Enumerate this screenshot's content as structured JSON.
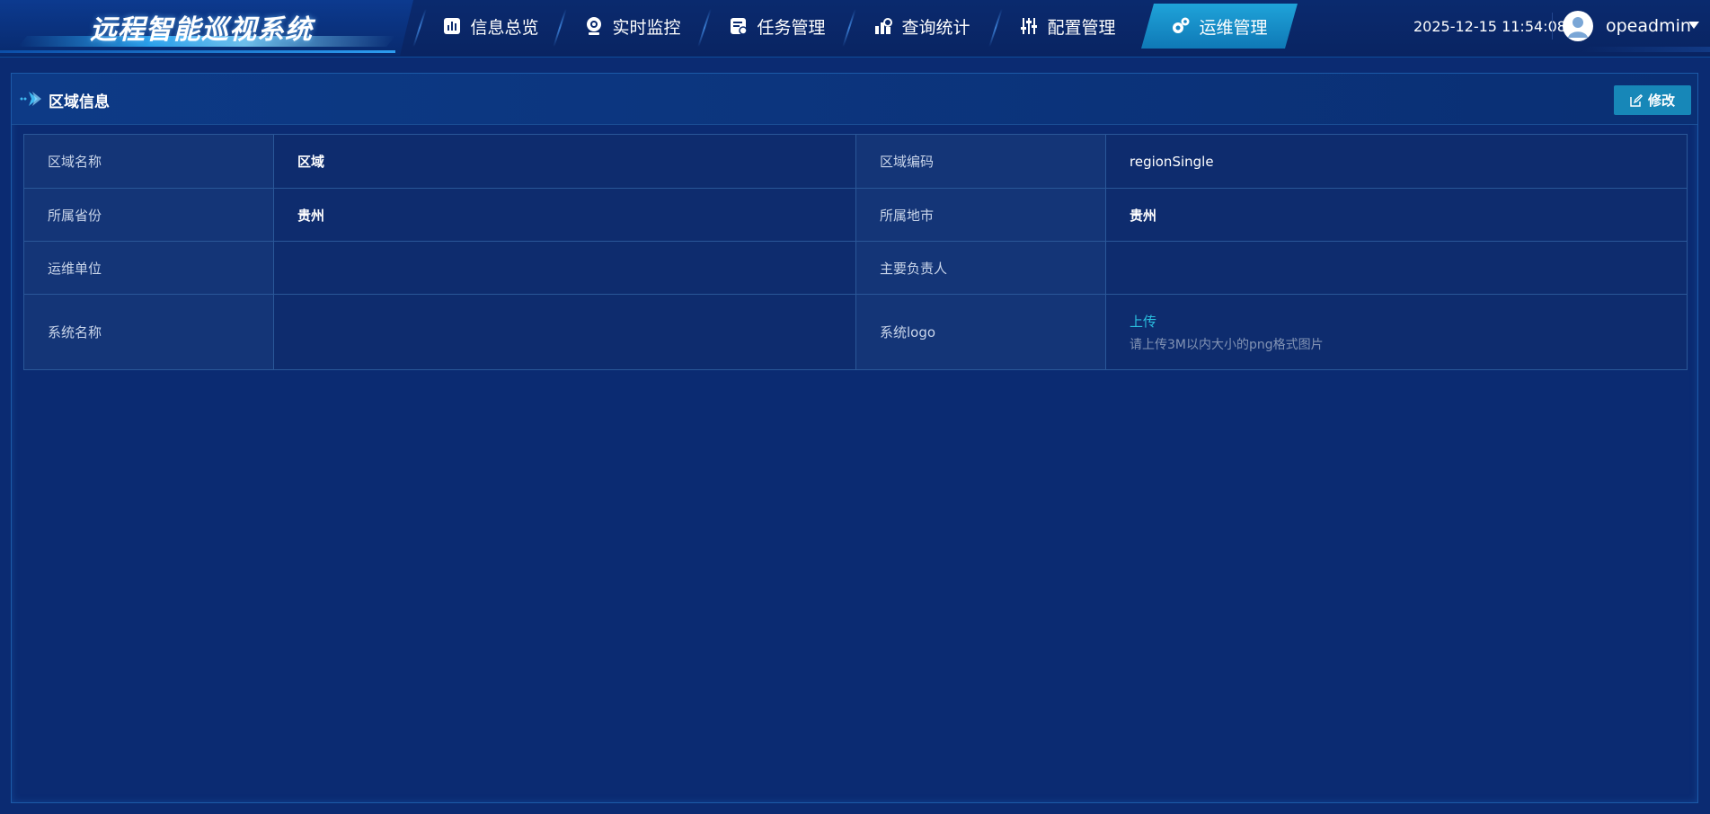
{
  "app": {
    "title": "远程智能巡视系统"
  },
  "nav": {
    "items": [
      {
        "label": "信息总览",
        "icon": "chart-icon",
        "active": false
      },
      {
        "label": "实时监控",
        "icon": "camera-icon",
        "active": false
      },
      {
        "label": "任务管理",
        "icon": "task-icon",
        "active": false
      },
      {
        "label": "查询统计",
        "icon": "stats-icon",
        "active": false
      },
      {
        "label": "配置管理",
        "icon": "sliders-icon",
        "active": false
      },
      {
        "label": "运维管理",
        "icon": "gears-icon",
        "active": true
      }
    ]
  },
  "header": {
    "datetime": "2025-12-15 11:54:08",
    "username": "opeadmin"
  },
  "panel": {
    "title": "区域信息",
    "edit_label": "修改"
  },
  "info": {
    "region_name_label": "区域名称",
    "region_name": "区域",
    "region_code_label": "区域编码",
    "region_code": "regionSingle",
    "province_label": "所属省份",
    "province": "贵州",
    "city_label": "所属地市",
    "city": "贵州",
    "maint_unit_label": "运维单位",
    "maint_unit": "",
    "owner_label": "主要负责人",
    "owner": "",
    "system_name_label": "系统名称",
    "system_name": "",
    "system_logo_label": "系统logo",
    "upload_label": "上传",
    "upload_hint": "请上传3M以内大小的png格式图片"
  },
  "colors": {
    "background": "#0b2b72",
    "accent": "#1787b8",
    "active_tab": "#1fa3d9",
    "link": "#2bc0e0",
    "border": "#2a5798"
  }
}
